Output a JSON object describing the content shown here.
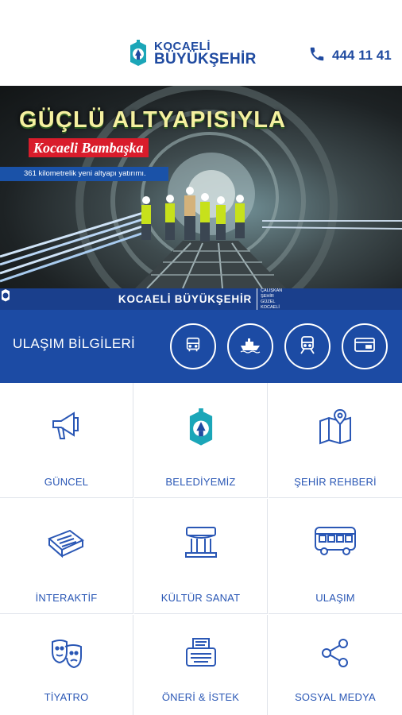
{
  "header": {
    "logo_line1": "KOCAELİ",
    "logo_line2": "BÜYÜKŞEHİR",
    "phone_icon": "phone-icon",
    "phone_number": "444 11 41"
  },
  "banner": {
    "headline": "GÜÇLÜ ALTYAPISIYLA",
    "subline": "Kocaeli Bambaşka",
    "info_text": "361 kilometrelik yeni altyapı yatırımı.",
    "footer_brand": "KOCAELİ BÜYÜKŞEHİR",
    "footer_slogan": "ÇALIŞKAN ŞEHİR GÜZEL KOCAELİ"
  },
  "transport": {
    "title": "ULAŞIM BİLGİLERİ",
    "buttons": [
      {
        "icon": "bus-icon"
      },
      {
        "icon": "ferry-icon"
      },
      {
        "icon": "tram-icon"
      },
      {
        "icon": "card-icon"
      }
    ]
  },
  "menu": [
    {
      "label": "GÜNCEL",
      "icon": "megaphone-icon"
    },
    {
      "label": "BELEDİYEMİZ",
      "icon": "municipality-logo-icon"
    },
    {
      "label": "ŞEHİR REHBERİ",
      "icon": "map-icon"
    },
    {
      "label": "İNTERAKTİF",
      "icon": "interactive-cards-icon"
    },
    {
      "label": "KÜLTÜR SANAT",
      "icon": "building-columns-icon"
    },
    {
      "label": "ULAŞIM",
      "icon": "bus-icon"
    },
    {
      "label": "TİYATRO",
      "icon": "theater-masks-icon"
    },
    {
      "label": "ÖNERİ & İSTEK",
      "icon": "typewriter-icon"
    },
    {
      "label": "SOSYAL MEDYA",
      "icon": "share-icon"
    }
  ],
  "colors": {
    "brand_blue": "#1c4ba4",
    "label_blue": "#2a57b5",
    "logo_teal": "#1ba6b8"
  }
}
